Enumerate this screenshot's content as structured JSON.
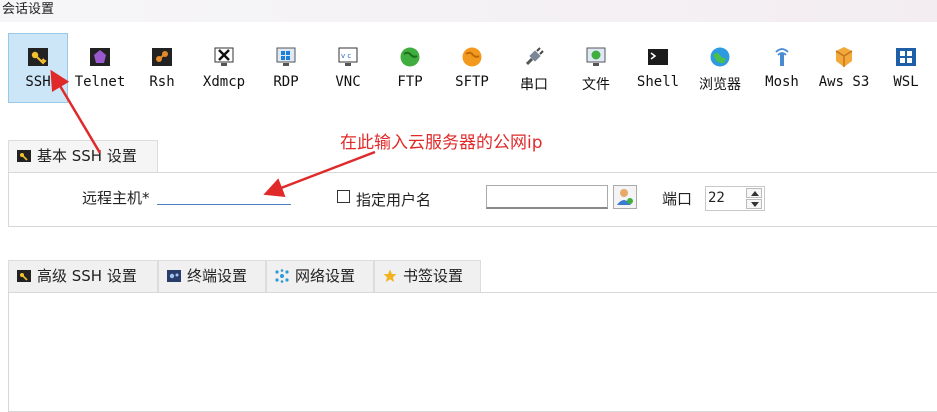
{
  "window": {
    "title": "会话设置"
  },
  "protocols": [
    {
      "label": "SSH",
      "icon": "key-icon",
      "selected": true
    },
    {
      "label": "Telnet",
      "icon": "telnet-icon",
      "selected": false
    },
    {
      "label": "Rsh",
      "icon": "rsh-icon",
      "selected": false
    },
    {
      "label": "Xdmcp",
      "icon": "xdmcp-icon",
      "selected": false
    },
    {
      "label": "RDP",
      "icon": "rdp-icon",
      "selected": false
    },
    {
      "label": "VNC",
      "icon": "vnc-icon",
      "selected": false
    },
    {
      "label": "FTP",
      "icon": "ftp-globe-icon",
      "selected": false
    },
    {
      "label": "SFTP",
      "icon": "sftp-globe-icon",
      "selected": false
    },
    {
      "label": "串口",
      "icon": "serial-plug-icon",
      "selected": false
    },
    {
      "label": "文件",
      "icon": "file-icon",
      "selected": false
    },
    {
      "label": "Shell",
      "icon": "shell-icon",
      "selected": false
    },
    {
      "label": "浏览器",
      "icon": "browser-globe-icon",
      "selected": false
    },
    {
      "label": "Mosh",
      "icon": "mosh-icon",
      "selected": false
    },
    {
      "label": "Aws S3",
      "icon": "aws-s3-icon",
      "selected": false
    },
    {
      "label": "WSL",
      "icon": "windows-icon",
      "selected": false
    }
  ],
  "basic_tab": {
    "label": "基本 SSH 设置"
  },
  "basic": {
    "host_label": "远程主机*",
    "host_value": "",
    "specify_user_label": "指定用户名",
    "specify_user_checked": false,
    "username_value": "",
    "port_label": "端口",
    "port_value": "22"
  },
  "bottom_tabs": [
    {
      "label": "高级 SSH 设置",
      "icon": "key-icon"
    },
    {
      "label": "终端设置",
      "icon": "terminal-icon"
    },
    {
      "label": "网络设置",
      "icon": "network-icon"
    },
    {
      "label": "书签设置",
      "icon": "star-icon"
    }
  ],
  "annotation": {
    "text": "在此输入云服务器的公网ip",
    "color": "#e02a2a"
  },
  "colors": {
    "selected_bg": "#cce6f7",
    "input_underline": "#4a7fc0"
  }
}
